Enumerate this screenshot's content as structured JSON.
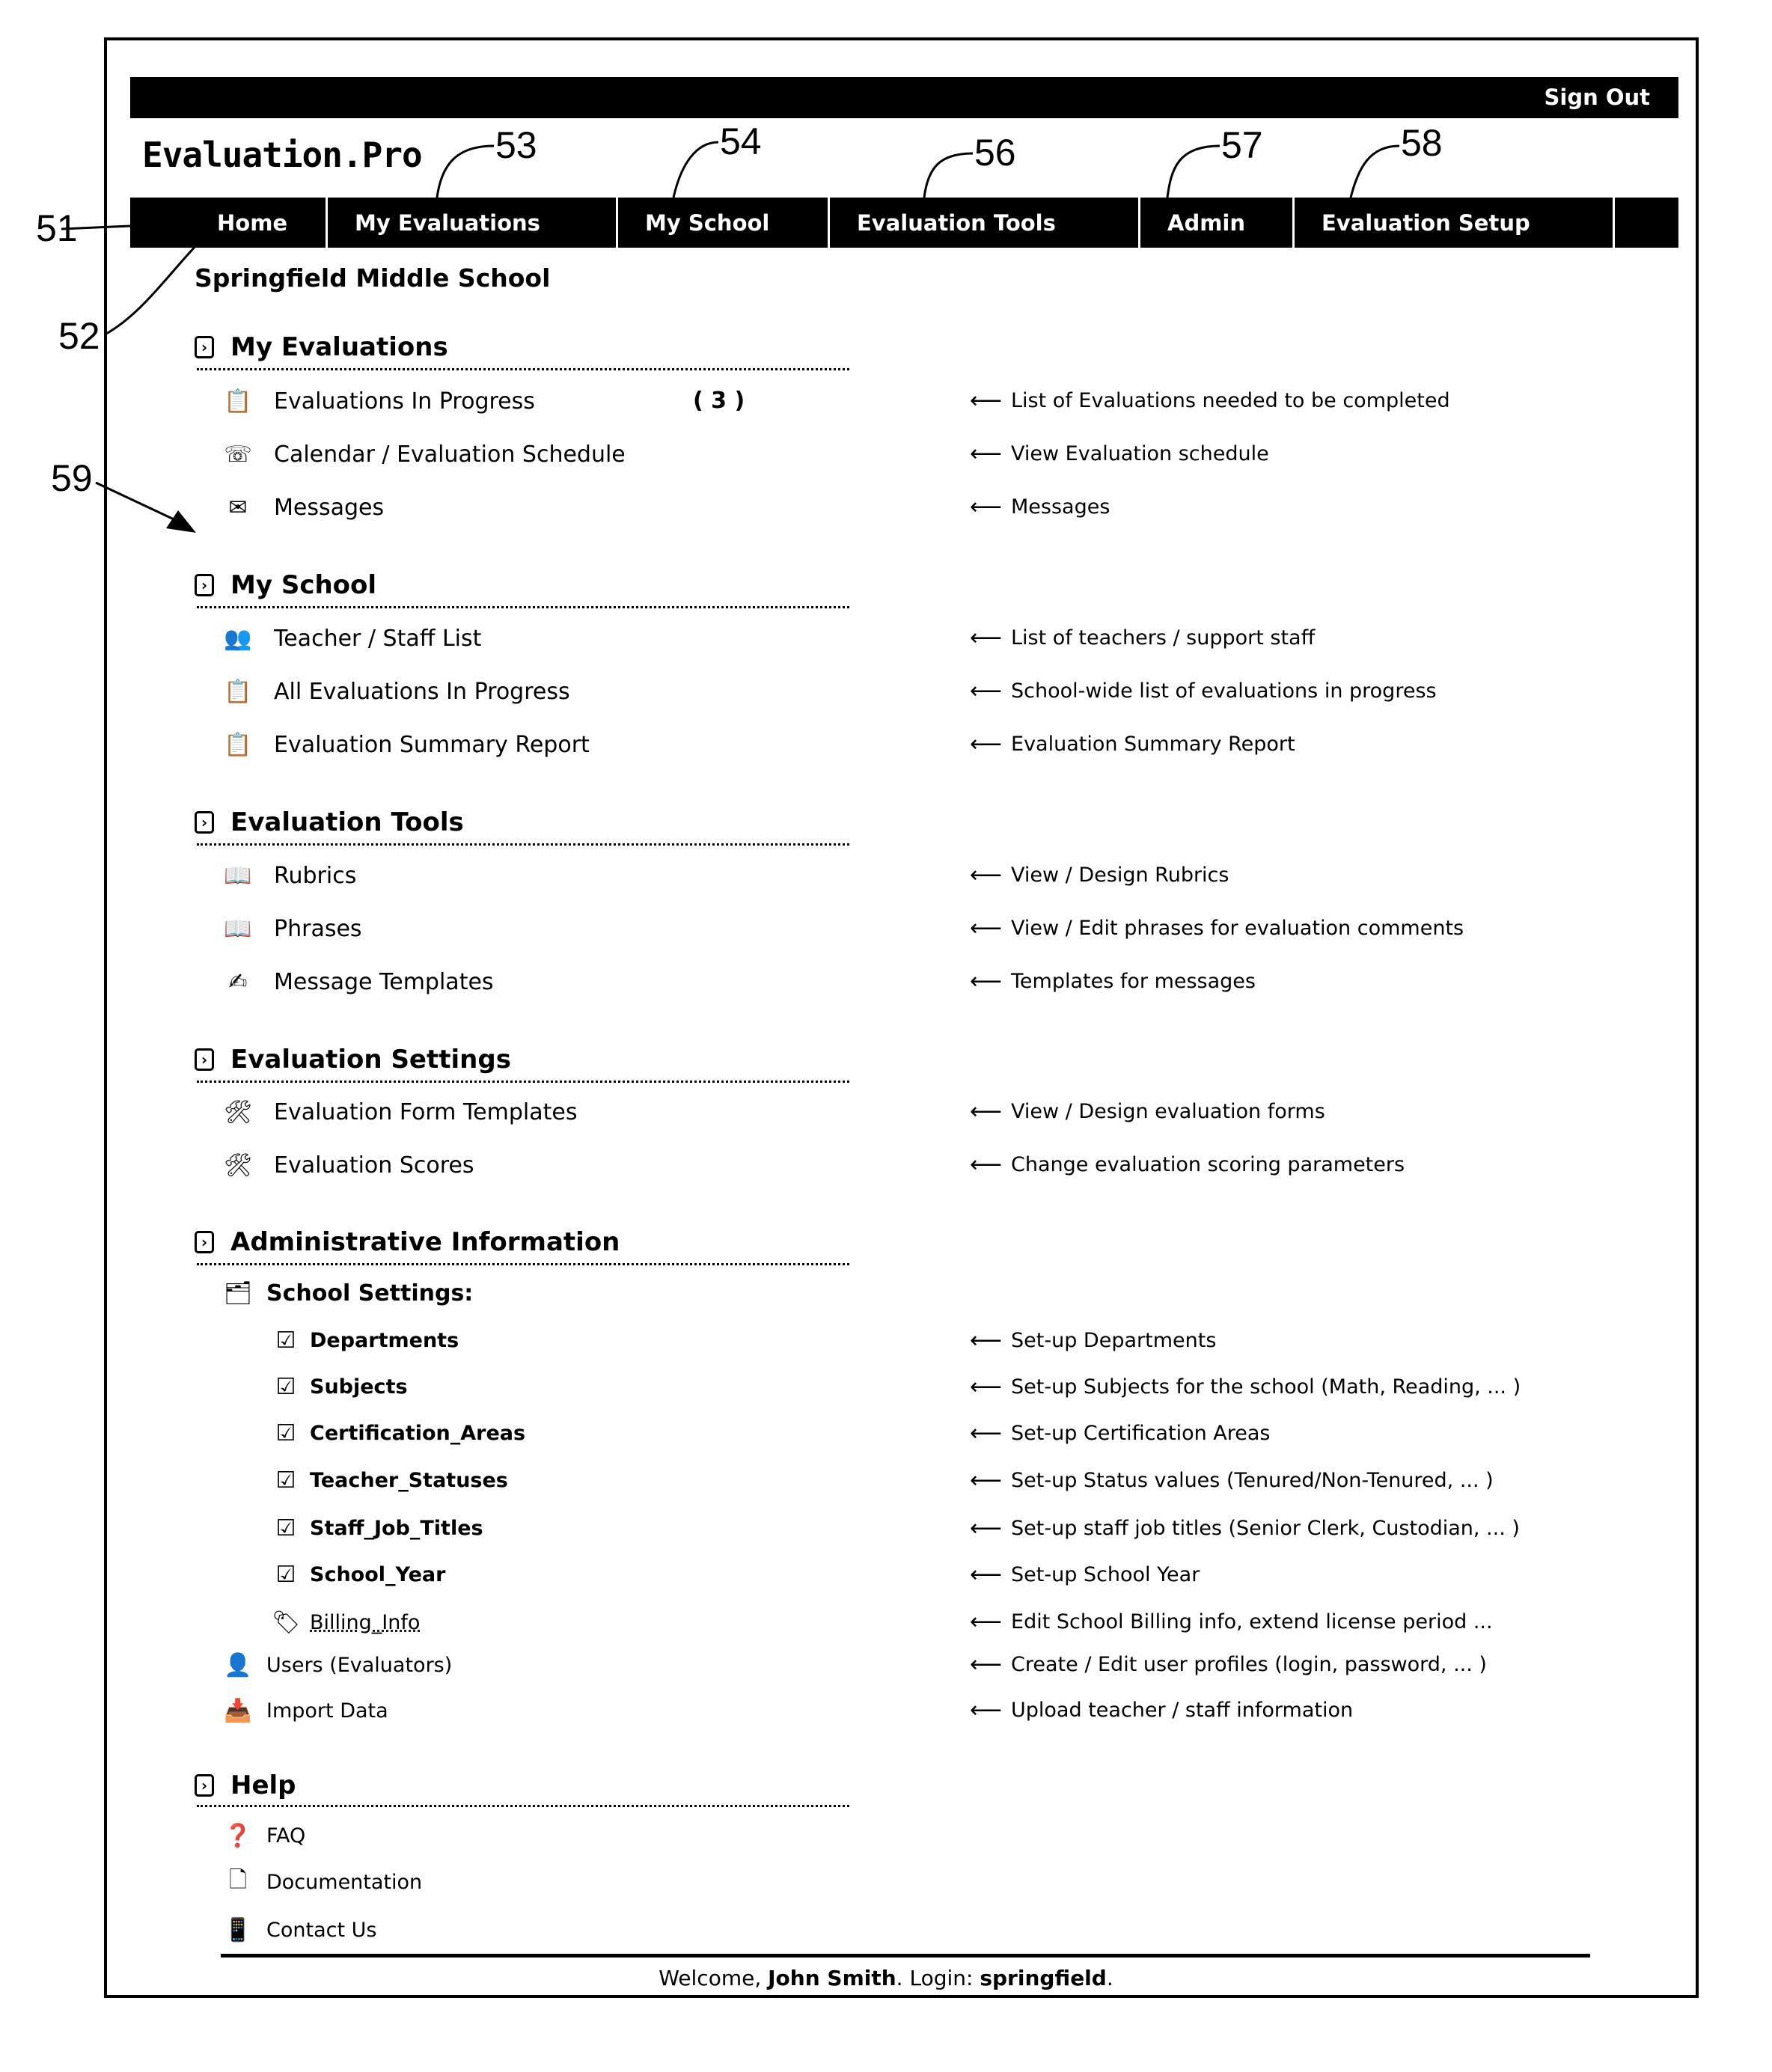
{
  "app": {
    "logo": "Evaluation.Pro",
    "sign_out": "Sign Out",
    "school_name": "Springfield Middle School"
  },
  "nav": {
    "tabs": [
      {
        "label": "Home"
      },
      {
        "label": "My Evaluations"
      },
      {
        "label": "My School"
      },
      {
        "label": "Evaluation Tools"
      },
      {
        "label": "Admin"
      },
      {
        "label": "Evaluation Setup"
      },
      {
        "label": ""
      }
    ]
  },
  "annotations": {
    "a51": "51",
    "a52": "52",
    "a53": "53",
    "a54": "54",
    "a56": "56",
    "a57": "57",
    "a58": "58",
    "a59": "59"
  },
  "sections": {
    "my_evaluations": {
      "title": "My Evaluations",
      "items": [
        {
          "label": "Evaluations In Progress",
          "count": "( 3 )",
          "icon": "evaluation-clipboard-icon",
          "desc": "List of Evaluations needed to be completed"
        },
        {
          "label": "Calendar / Evaluation Schedule",
          "icon": "calendar-schedule-icon",
          "desc": "View Evaluation schedule"
        },
        {
          "label": "Messages",
          "icon": "envelope-icon",
          "desc": "Messages"
        }
      ]
    },
    "my_school": {
      "title": "My School",
      "items": [
        {
          "label": "Teacher / Staff List",
          "icon": "people-icon",
          "desc": "List of teachers / support staff"
        },
        {
          "label": "All Evaluations In Progress",
          "icon": "evaluation-clipboard-icon",
          "desc": "School-wide list of evaluations in progress"
        },
        {
          "label": "Evaluation Summary Report",
          "icon": "evaluation-clipboard-icon",
          "desc": "Evaluation Summary Report"
        }
      ]
    },
    "evaluation_tools": {
      "title": "Evaluation Tools",
      "items": [
        {
          "label": "Rubrics",
          "icon": "open-book-icon",
          "desc": "View / Design Rubrics"
        },
        {
          "label": "Phrases",
          "icon": "open-book-icon",
          "desc": "View / Edit phrases for evaluation comments"
        },
        {
          "label": "Message Templates",
          "icon": "pen-writing-icon",
          "desc": "Templates for messages"
        }
      ]
    },
    "evaluation_settings": {
      "title": "Evaluation Settings",
      "items": [
        {
          "label": "Evaluation Form Templates",
          "icon": "tools-icon",
          "desc": "View / Design evaluation forms"
        },
        {
          "label": "Evaluation Scores",
          "icon": "tools-icon",
          "desc": "Change evaluation scoring parameters"
        }
      ]
    },
    "administrative_information": {
      "title": "Administrative Information",
      "school_settings_label": "School Settings:",
      "school_settings": [
        {
          "label": "Departments",
          "icon": "checklist-icon",
          "desc": "Set-up Departments"
        },
        {
          "label": "Subjects",
          "icon": "checklist-icon",
          "desc": "Set-up Subjects for the school (Math, Reading, ... )"
        },
        {
          "label": "Certification_Areas",
          "icon": "checklist-icon",
          "desc": "Set-up Certification Areas"
        },
        {
          "label": "Teacher_Statuses",
          "icon": "checklist-icon",
          "desc": "Set-up Status values (Tenured/Non-Tenured, ... )"
        },
        {
          "label": "Staff_Job_Titles",
          "icon": "checklist-icon",
          "desc": "Set-up staff job titles (Senior Clerk, Custodian, ... )"
        },
        {
          "label": "School_Year",
          "icon": "checklist-icon",
          "desc": "Set-up School Year"
        },
        {
          "label": "Billing_Info",
          "icon": "billing-icon",
          "desc": "Edit School Billing info, extend license period ..."
        }
      ],
      "items": [
        {
          "label": "Users (Evaluators)",
          "icon": "users-icon",
          "desc": "Create / Edit user profiles (login, password, ... )"
        },
        {
          "label": "Import Data",
          "icon": "import-icon",
          "desc": "Upload teacher / staff information"
        }
      ]
    },
    "help": {
      "title": "Help",
      "items": [
        {
          "label": "FAQ",
          "icon": "question-icon"
        },
        {
          "label": "Documentation",
          "icon": "document-icon"
        },
        {
          "label": "Contact Us",
          "icon": "phone-icon"
        }
      ]
    }
  },
  "footer": {
    "welcome_prefix": "Welcome, ",
    "user_name": "John Smith",
    "login_prefix": ". Login: ",
    "login": "springfield",
    "suffix": "."
  }
}
